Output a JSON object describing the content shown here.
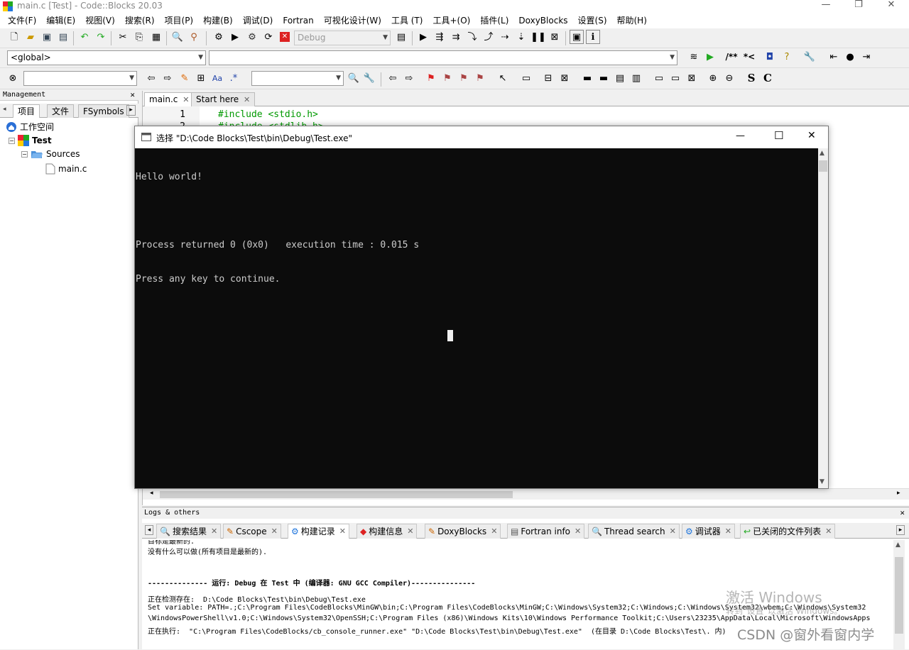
{
  "window": {
    "title": "main.c [Test] - Code::Blocks 20.03",
    "minimize": "—",
    "maximize": "❐",
    "close": "✕"
  },
  "menu": [
    "文件(F)",
    "编辑(E)",
    "视图(V)",
    "搜索(R)",
    "项目(P)",
    "构建(B)",
    "调试(D)",
    "Fortran",
    "可视化设计(W)",
    "工具 (T)",
    "工具+(O)",
    "插件(L)",
    "DoxyBlocks",
    "设置(S)",
    "帮助(H)"
  ],
  "toolbar": {
    "build_target": "Debug",
    "scope": "<global>",
    "symbol": "",
    "search_text": "",
    "regex_label": ".*",
    "comment_label": "/**",
    "uncomment_label": "*<",
    "s_label": "S",
    "c_label": "C"
  },
  "management": {
    "header": "Management",
    "close": "✕",
    "tabs": [
      "项目",
      "文件",
      "FSymbols"
    ],
    "tree": {
      "workspace": "工作空间",
      "project": "Test",
      "folder": "Sources",
      "file": "main.c"
    }
  },
  "editor": {
    "tabs": [
      {
        "label": "main.c",
        "close": "✕"
      },
      {
        "label": "Start here",
        "close": "✕"
      }
    ],
    "lines": [
      {
        "num": "1",
        "code": "#include <stdio.h>"
      },
      {
        "num": "2",
        "code": "#include <stdlib.h>"
      }
    ]
  },
  "console": {
    "title": "选择 \"D:\\Code Blocks\\Test\\bin\\Debug\\Test.exe\"",
    "minimize": "—",
    "maximize": "☐",
    "close": "✕",
    "lines": [
      "Hello world!",
      "",
      "Process returned 0 (0x0)   execution time : 0.015 s",
      "Press any key to continue."
    ]
  },
  "logs": {
    "header": "Logs & others",
    "close": "✕",
    "tabs": [
      {
        "label": "搜索结果",
        "icon": "search-icon"
      },
      {
        "label": "Cscope",
        "icon": "doc-icon"
      },
      {
        "label": "构建记录",
        "icon": "gear-icon"
      },
      {
        "label": "构建信息",
        "icon": "diamond-icon"
      },
      {
        "label": "DoxyBlocks",
        "icon": "doc-icon"
      },
      {
        "label": "Fortran info",
        "icon": "doc-icon"
      },
      {
        "label": "Thread search",
        "icon": "search-icon"
      },
      {
        "label": "调试器",
        "icon": "gear-icon"
      },
      {
        "label": "已关闭的文件列表",
        "icon": "arrow-icon"
      }
    ],
    "lines": [
      "目标是最新的.",
      "没有什么可以做(所有项目是最新的).",
      "",
      "",
      "-------------- 运行: Debug 在 Test 中 (编译器: GNU GCC Compiler)---------------",
      "",
      "正在检测存在:  D:\\Code Blocks\\Test\\bin\\Debug\\Test.exe",
      "Set variable: PATH=.;C:\\Program Files\\CodeBlocks\\MinGW\\bin;C:\\Program Files\\CodeBlocks\\MinGW;C:\\Windows\\System32;C:\\Windows;C:\\Windows\\System32\\wbem;C:\\Windows\\System32",
      "\\WindowsPowerShell\\v1.0;C:\\Windows\\System32\\OpenSSH;C:\\Program Files (x86)\\Windows Kits\\10\\Windows Performance Toolkit;C:\\Users\\23235\\AppData\\Local\\Microsoft\\WindowsApps",
      "正在执行:  \"C:\\Program Files\\CodeBlocks/cb_console_runner.exe\" \"D:\\Code Blocks\\Test\\bin\\Debug\\Test.exe\"  (在目录 D:\\Code Blocks\\Test\\. 内)"
    ]
  },
  "watermark": {
    "activate": "激活 Windows",
    "activate_sub": "转到\"设置\"以激活 Windows。",
    "csdn": "CSDN @窗外看窗内学"
  },
  "colors": {
    "highlight": "#e00000",
    "console_bg": "#0c0c0c",
    "code_green": "#009900"
  }
}
